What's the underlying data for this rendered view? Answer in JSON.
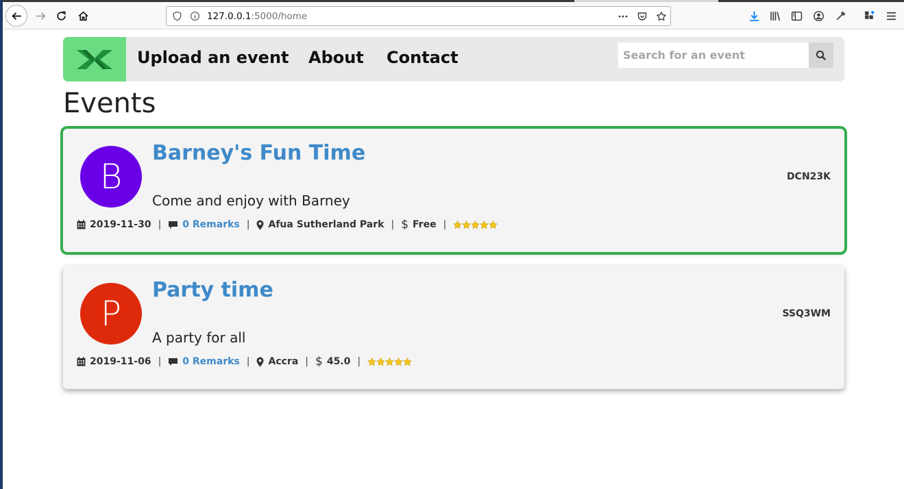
{
  "browser": {
    "url_host": "127.0.0.1",
    "url_rest": ":5000/home"
  },
  "nav": {
    "links": [
      "Upload an event",
      "About",
      "Contact"
    ],
    "search_placeholder": "Search for an event"
  },
  "page": {
    "title": "Events"
  },
  "events": [
    {
      "avatar_letter": "B",
      "avatar_color": "#6a00e6",
      "title": "Barney's Fun Time",
      "code": "DCN23K",
      "description": "Come and enjoy with Barney",
      "date": "2019-11-30",
      "remarks": "0 Remarks",
      "location": "Afua Sutherland Park",
      "price": "Free",
      "rating": 5
    },
    {
      "avatar_letter": "P",
      "avatar_color": "#de2a0b",
      "title": "Party time",
      "code": "SSQ3WM",
      "description": "A party for all",
      "date": "2019-11-06",
      "remarks": "0 Remarks",
      "location": "Accra",
      "price": "45.0",
      "rating": 5
    }
  ]
}
